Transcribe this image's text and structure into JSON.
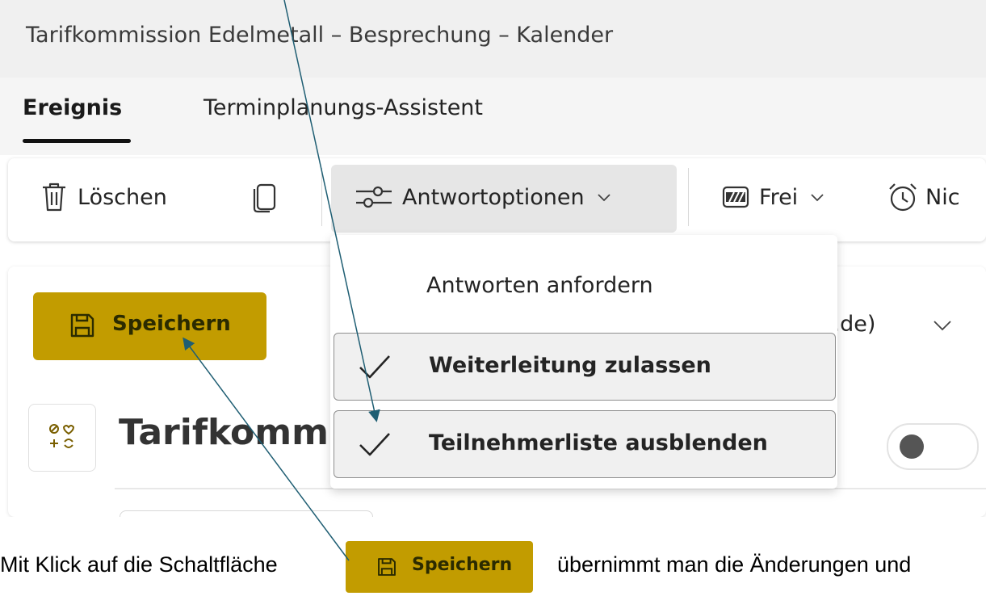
{
  "window": {
    "title": "Tarifkommission Edelmetall – Besprechung – Kalender"
  },
  "tabs": [
    {
      "label": "Ereignis",
      "active": true
    },
    {
      "label": "Terminplanungs-Assistent",
      "active": false
    }
  ],
  "toolbar": {
    "delete_label": "Löschen",
    "response_options_label": "Antwortoptionen",
    "status_label": "Frei",
    "reminder_label_partial": "Nic"
  },
  "form": {
    "save_label": "Speichern",
    "email_partial": "all.de)",
    "title_partial": "Tarifkomm"
  },
  "response_menu": {
    "items": [
      {
        "label": "Antworten anfordern",
        "checked": false
      },
      {
        "label": "Weiterleitung zulassen",
        "checked": true
      },
      {
        "label": "Teilnehmerliste ausblenden",
        "checked": true
      }
    ]
  },
  "caption": {
    "prefix": "Mit Klick auf die Schaltfläche",
    "button_label": "Speichern",
    "suffix": "übernimmt man die Änderungen und"
  },
  "colors": {
    "accent": "#c29c00",
    "annotation_arrow": "#1f5e73"
  },
  "icons": [
    "trash-icon",
    "copy-icon",
    "sliders-icon",
    "chevron-down-icon",
    "busy-status-icon",
    "alarm-clock-icon",
    "save-icon",
    "category-icon",
    "checkmark-icon"
  ]
}
